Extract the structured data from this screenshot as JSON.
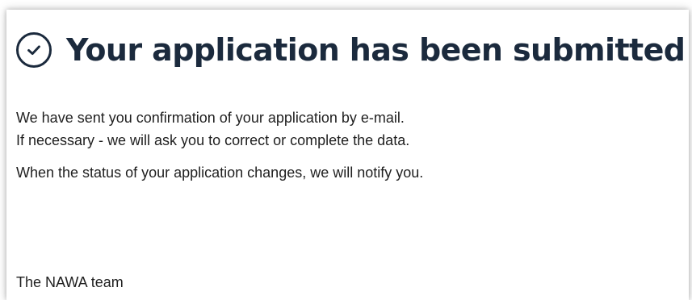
{
  "title": "Your application has been submitted",
  "icons": {
    "status": "check-circle-icon"
  },
  "colors": {
    "heading": "#1b2a3d",
    "text": "#1f1f1f",
    "background": "#ffffff"
  },
  "message": {
    "line1": "We have sent you confirmation of your application by e-mail.",
    "line2": "If necessary - we will ask you to correct or complete the data.",
    "line3": "When the status of your application changes, we will notify you."
  },
  "signature": "The NAWA team"
}
